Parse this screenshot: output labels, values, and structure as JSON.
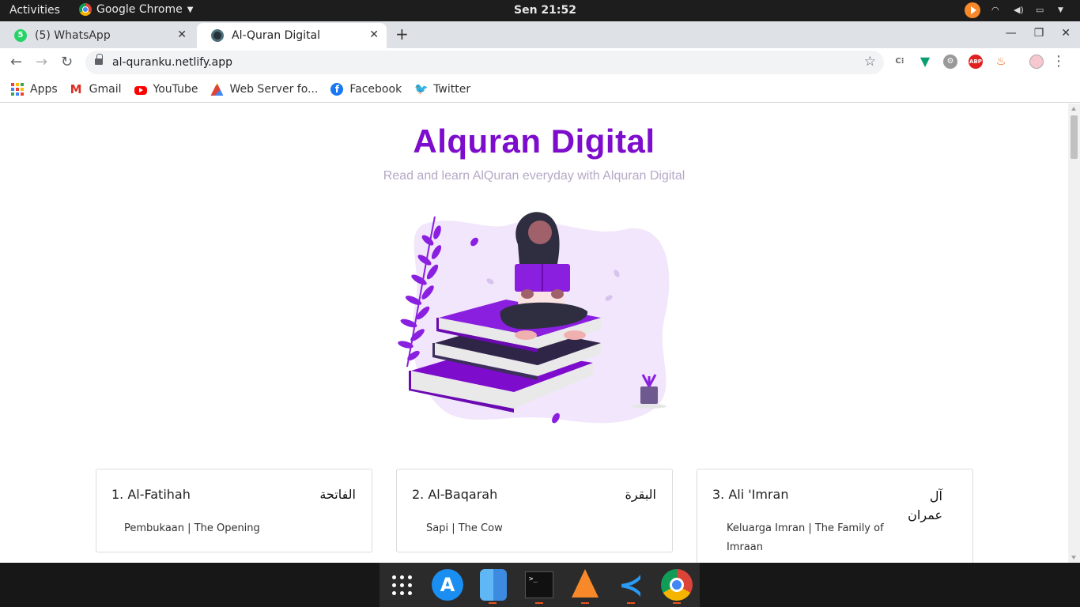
{
  "system_bar": {
    "activities": "Activities",
    "app_name": "Google Chrome",
    "clock": "Sen 21:52"
  },
  "tabs": [
    {
      "title": "(5) WhatsApp",
      "favicon_badge": "5",
      "icon": "whatsapp-icon"
    },
    {
      "title": "Al-Quran Digital",
      "icon": "quran-site-icon"
    }
  ],
  "toolbar": {
    "url": "al-quranku.netlify.app"
  },
  "bookmarks": [
    {
      "label": "Apps",
      "icon": "apps-grid-icon"
    },
    {
      "label": "Gmail",
      "icon": "gmail-icon"
    },
    {
      "label": "YouTube",
      "icon": "youtube-icon"
    },
    {
      "label": "Web Server fo...",
      "icon": "web-server-icon"
    },
    {
      "label": "Facebook",
      "icon": "facebook-icon"
    },
    {
      "label": "Twitter",
      "icon": "twitter-icon"
    }
  ],
  "page": {
    "title": "Alquran Digital",
    "subtitle": "Read and learn AlQuran everyday with Alquran Digital",
    "accent_color": "#7d0ccc",
    "surahs": [
      {
        "name": "1. Al-Fatihah",
        "arabic": "الفاتحة",
        "meaning": "Pembukaan | The Opening"
      },
      {
        "name": "2. Al-Baqarah",
        "arabic": "البقرة",
        "meaning": "Sapi | The Cow"
      },
      {
        "name": "3. Ali 'Imran",
        "arabic_line1": "آل",
        "arabic_line2": "عمران",
        "meaning_line1": "Keluarga Imran | The Family of",
        "meaning_line2": "Imraan"
      }
    ]
  },
  "dock": [
    {
      "name": "show-applications-icon"
    },
    {
      "name": "app-store-icon"
    },
    {
      "name": "finder-icon"
    },
    {
      "name": "terminal-icon",
      "text": ">_"
    },
    {
      "name": "vlc-icon"
    },
    {
      "name": "vscode-icon"
    },
    {
      "name": "chrome-icon"
    }
  ]
}
